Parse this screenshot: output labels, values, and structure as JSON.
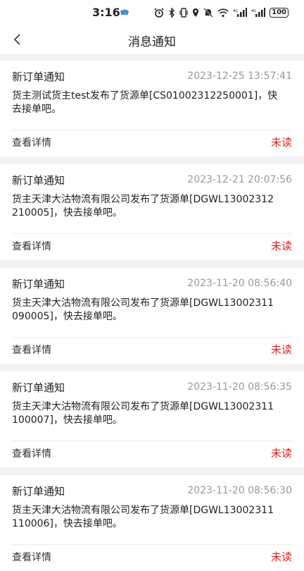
{
  "status_bar": {
    "time": "3:16",
    "battery": "100"
  },
  "header": {
    "title": "消息通知"
  },
  "messages": [
    {
      "title": "新订单通知",
      "time": "2023-12-25 13:57:41",
      "body": "货主测试货主test发布了货源单[CS01002312250001]，快去接单吧。",
      "detail_label": "查看详情",
      "status": "未读"
    },
    {
      "title": "新订单通知",
      "time": "2023-12-21 20:07:56",
      "body": "货主天津大沽物流有限公司发布了货源单[DGWL13002312210005]，快去接单吧。",
      "detail_label": "查看详情",
      "status": "未读"
    },
    {
      "title": "新订单通知",
      "time": "2023-11-20 08:56:40",
      "body": "货主天津大沽物流有限公司发布了货源单[DGWL13002311090005]，快去接单吧。",
      "detail_label": "查看详情",
      "status": "未读"
    },
    {
      "title": "新订单通知",
      "time": "2023-11-20 08:56:35",
      "body": "货主天津大沽物流有限公司发布了货源单[DGWL13002311100007]，快去接单吧。",
      "detail_label": "查看详情",
      "status": "未读"
    },
    {
      "title": "新订单通知",
      "time": "2023-11-20 08:56:30",
      "body": "货主天津大沽物流有限公司发布了货源单[DGWL13002311110006]，快去接单吧。",
      "detail_label": "查看详情",
      "status": "未读"
    }
  ],
  "colors": {
    "unread": "#e0201a",
    "timestamp": "#999999",
    "background": "#f2f2f2"
  }
}
